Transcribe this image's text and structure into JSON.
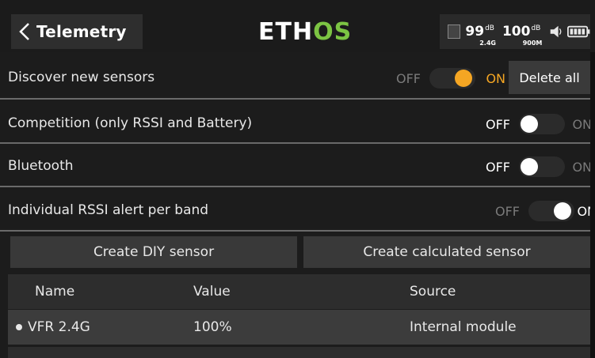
{
  "header": {
    "title": "Telemetry",
    "logo_main": "ETH",
    "logo_accent": "OS",
    "rssi_24": {
      "value": "99",
      "unit": "dB",
      "band": "2.4G"
    },
    "rssi_900": {
      "value": "100",
      "unit": "dB",
      "band": "900M"
    }
  },
  "settings": [
    {
      "label": "Discover new sensors",
      "off": "OFF",
      "on": "ON",
      "state": "on",
      "knob_color": "#f5a623"
    },
    {
      "label": "Competition (only RSSI and Battery)",
      "off": "OFF",
      "on": "ON",
      "state": "off"
    },
    {
      "label": "Bluetooth",
      "off": "OFF",
      "on": "ON",
      "state": "off"
    },
    {
      "label": "Individual RSSI alert per band",
      "off": "OFF",
      "on": "ON",
      "state": "on",
      "knob_color": "#ffffff"
    }
  ],
  "delete_all_label": "Delete all",
  "actions": {
    "create_diy": "Create DIY sensor",
    "create_calculated": "Create calculated sensor"
  },
  "table": {
    "columns": [
      "Name",
      "Value",
      "Source"
    ],
    "rows": [
      {
        "name": "VFR 2.4G",
        "value": "100%",
        "source": "Internal module"
      }
    ]
  },
  "colors": {
    "background": "#1c1c1c",
    "accent_orange": "#f5a623",
    "logo_green": "#7cc443"
  }
}
